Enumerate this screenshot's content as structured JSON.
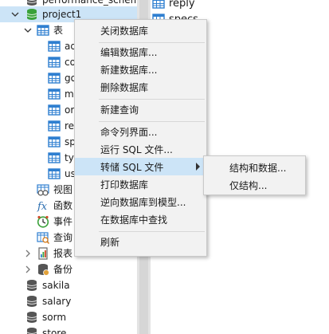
{
  "tree": {
    "items": [
      {
        "label": "performance_schema",
        "icon": "database-icon"
      },
      {
        "label": "project1",
        "icon": "database-icon"
      },
      {
        "label": "表",
        "icon": "table-group-icon"
      },
      {
        "label": "ad",
        "icon": "table-icon"
      },
      {
        "label": "co",
        "icon": "table-icon"
      },
      {
        "label": "go",
        "icon": "table-icon"
      },
      {
        "label": "m",
        "icon": "table-icon"
      },
      {
        "label": "or",
        "icon": "table-icon"
      },
      {
        "label": "re",
        "icon": "table-icon"
      },
      {
        "label": "sp",
        "icon": "table-icon"
      },
      {
        "label": "ty",
        "icon": "table-icon"
      },
      {
        "label": "us",
        "icon": "table-icon"
      },
      {
        "label": "视图",
        "icon": "view-icon"
      },
      {
        "label": "函数",
        "icon": "function-icon"
      },
      {
        "label": "事件",
        "icon": "event-icon"
      },
      {
        "label": "查询",
        "icon": "query-icon"
      },
      {
        "label": "报表",
        "icon": "report-icon"
      },
      {
        "label": "备份",
        "icon": "backup-icon"
      },
      {
        "label": "sakila",
        "icon": "database-icon"
      },
      {
        "label": "salary",
        "icon": "database-icon"
      },
      {
        "label": "sorm",
        "icon": "database-icon"
      },
      {
        "label": "store",
        "icon": "database-icon"
      }
    ]
  },
  "object_list": {
    "items": [
      {
        "label": "reply",
        "icon": "table-icon"
      },
      {
        "label": "specs",
        "icon": "table-icon"
      }
    ]
  },
  "context_menu": {
    "items": [
      {
        "label": "关闭数据库"
      },
      {
        "label": "编辑数据库..."
      },
      {
        "label": "新建数据库..."
      },
      {
        "label": "删除数据库"
      },
      {
        "label": "新建查询"
      },
      {
        "label": "命令列界面..."
      },
      {
        "label": "运行 SQL 文件..."
      },
      {
        "label": "转储 SQL 文件"
      },
      {
        "label": "打印数据库"
      },
      {
        "label": "逆向数据库到模型..."
      },
      {
        "label": "在数据库中查找"
      },
      {
        "label": "刷新"
      }
    ]
  },
  "submenu": {
    "items": [
      {
        "label": "结构和数据..."
      },
      {
        "label": "仅结构..."
      }
    ]
  },
  "colors": {
    "selection": "#cce4f7",
    "menu_bg": "#f2f2f2",
    "db_icon": "#4b4b4b",
    "db_selected_icon": "#3aa13a",
    "table_icon": "#2f7fd0"
  }
}
